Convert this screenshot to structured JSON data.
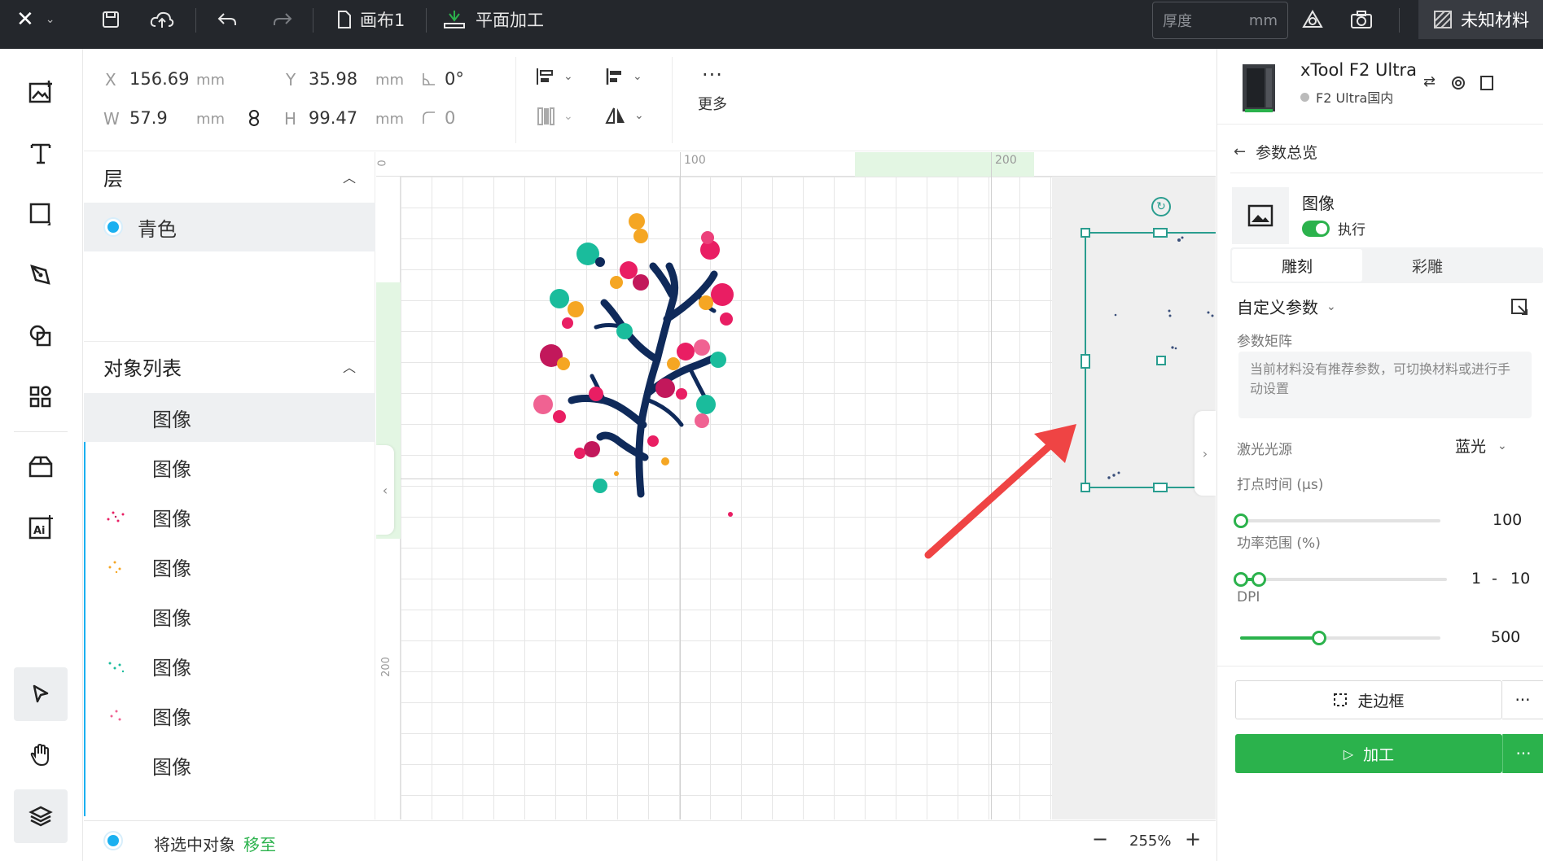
{
  "topbar": {
    "file_name": "画布1",
    "mode_label": "平面加工",
    "thickness_placeholder": "厚度",
    "thickness_unit": "mm",
    "material_label": "未知材料"
  },
  "properties": {
    "x_label": "X",
    "x_value": "156.69",
    "x_unit": "mm",
    "y_label": "Y",
    "y_value": "35.98",
    "y_unit": "mm",
    "rotation_value": "0°",
    "w_label": "W",
    "w_value": "57.9",
    "w_unit": "mm",
    "h_label": "H",
    "h_value": "99.47",
    "h_unit": "mm",
    "corner_value": "0",
    "more_label": "更多"
  },
  "layers_panel": {
    "title": "层",
    "layers": [
      {
        "name": "青色",
        "color": "#1ab0f0"
      }
    ],
    "objects_title": "对象列表",
    "objects": [
      {
        "label": "图像"
      },
      {
        "label": "图像"
      },
      {
        "label": "图像"
      },
      {
        "label": "图像"
      },
      {
        "label": "图像"
      },
      {
        "label": "图像"
      },
      {
        "label": "图像"
      },
      {
        "label": "图像"
      }
    ]
  },
  "canvas": {
    "ruler_top_labels": [
      "100",
      "200"
    ],
    "ruler_left_labels": [
      "0",
      "200"
    ]
  },
  "bottombar": {
    "move_text": "将选中对象",
    "move_link": "移至",
    "zoom_value": "255%"
  },
  "device": {
    "name": "xTool F2 Ultra",
    "status": "F2 Ultra国内"
  },
  "params": {
    "back_label": "参数总览",
    "item_title": "图像",
    "execute_label": "执行",
    "tab_engrave": "雕刻",
    "tab_color_engrave": "彩雕",
    "custom_params": "自定义参数",
    "matrix_label": "参数矩阵",
    "matrix_hint": "当前材料没有推荐参数，可切换材料或进行手动设置",
    "laser_source_label": "激光光源",
    "laser_source_value": "蓝光",
    "dot_time_label": "打点时间 (µs)",
    "dot_time_value": "100",
    "power_range_label": "功率范围 (%)",
    "power_min": "1",
    "power_sep": "-",
    "power_max": "10",
    "dpi_label": "DPI",
    "dpi_value": "500",
    "frame_button": "走边框",
    "process_button": "加工"
  },
  "colors": {
    "accent": "#2bb24c",
    "topbar_bg": "#24272c",
    "selection": "#2a9d8f",
    "layer_cyan": "#1ab0f0"
  }
}
